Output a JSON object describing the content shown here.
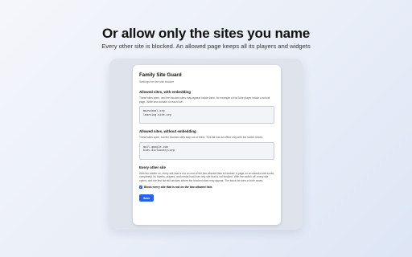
{
  "headline": "Or allow only the sites you name",
  "subheadline": "Every other site is blocked. An allowed page keeps all its players and widgets",
  "panel": {
    "title": "Family Site Guard",
    "subtitle": "Settings for the site blocker",
    "section_embedding": {
      "title": "Allowed sites, with embedding",
      "description": "These sites open, and the blocked sites may appear inside them, for example a YouTube player inside a school page. Write one domain on each line.",
      "lines": [
        "mozschool.org",
        "learning-site.org"
      ]
    },
    "section_no_embedding": {
      "title": "Allowed sites, without embedding",
      "description": "These sites open, but the blocked sites stay out of them. This list has an effect only with the switch below.",
      "lines": [
        "mail.google.com",
        "kids-dictionary.org"
      ]
    },
    "section_other": {
      "title": "Every other site",
      "description": "With the switch on, every site that is not on one of the two allowed lists is blocked. A page on an allowed site works completely. Its frames, players, and media load from any site that is not blocked. With the switch off, every site opens, and the first list still decides where the blocked sites may appear. The block list wins in both cases."
    },
    "checkbox": {
      "checked": true,
      "label": "Block every site that is not on the two allowed lists"
    },
    "save_label": "Save"
  },
  "colors": {
    "accent": "#2563eb",
    "frame": "#dfe4ec",
    "card": "#ffffff"
  }
}
